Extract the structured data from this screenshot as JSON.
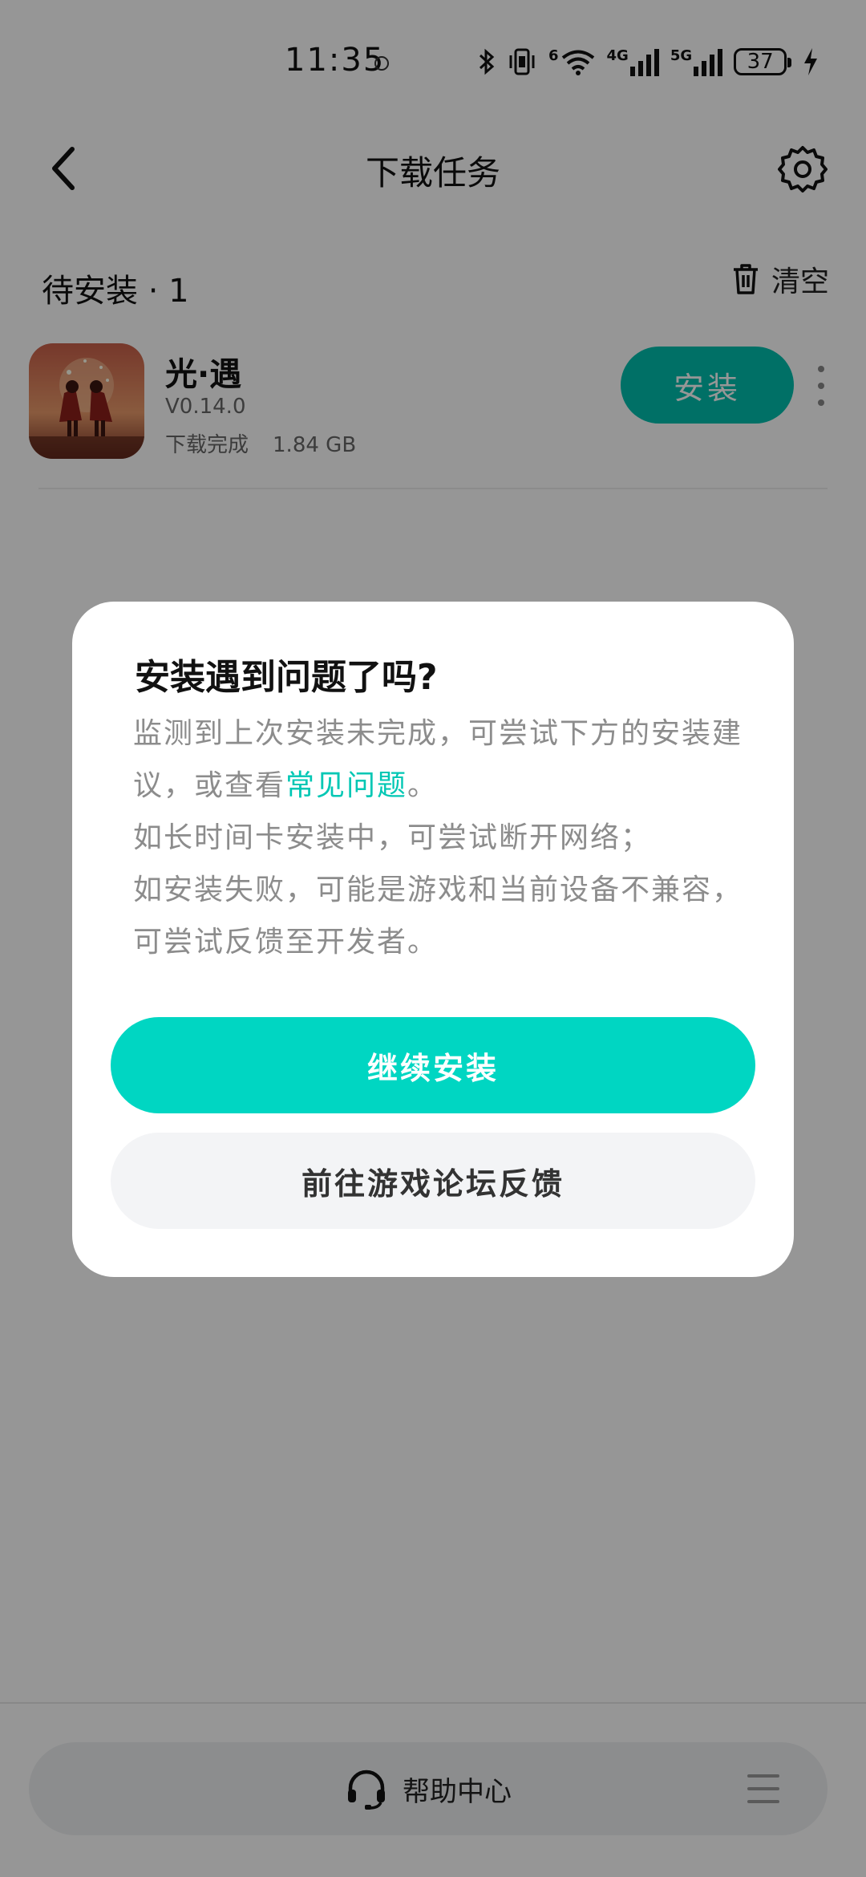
{
  "status_bar": {
    "time": "11:35",
    "network_1": "4G",
    "network_2": "5G",
    "wifi_badge": "6",
    "battery": "37",
    "icons": [
      "bluetooth-icon",
      "vibrate-icon",
      "wifi-icon",
      "signal-icon",
      "signal-icon",
      "battery-icon",
      "charging-icon"
    ]
  },
  "header": {
    "title": "下载任务",
    "back_icon": "back-arrow-icon",
    "settings_icon": "gear-icon"
  },
  "section": {
    "title": "待安装 · 1",
    "clear_label": "清空",
    "clear_icon": "trash-icon"
  },
  "app": {
    "name": "光·遇",
    "version": "V0.14.0",
    "status": "下载完成",
    "size": "1.84 GB",
    "install_label": "安装"
  },
  "dialog": {
    "title": "安装遇到问题了吗?",
    "body_part1": "监测到上次安装未完成，可尝试下方的安装建议，或查看",
    "faq_link": "常见问题",
    "body_part2": "。",
    "body_line2": "如长时间卡安装中，可尝试断开网络；",
    "body_line3": "如安装失败，可能是游戏和当前设备不兼容，可尝试反馈至开发者。",
    "primary_label": "继续安装",
    "secondary_label": "前往游戏论坛反馈"
  },
  "bottom": {
    "help_label": "帮助中心",
    "help_icon": "headset-icon",
    "menu_icon": "menu-icon"
  },
  "colors": {
    "accent": "#00d6c2",
    "install_button": "#00bfae",
    "link": "#00c7b4",
    "overlay": "rgba(0,0,0,0.41)"
  }
}
